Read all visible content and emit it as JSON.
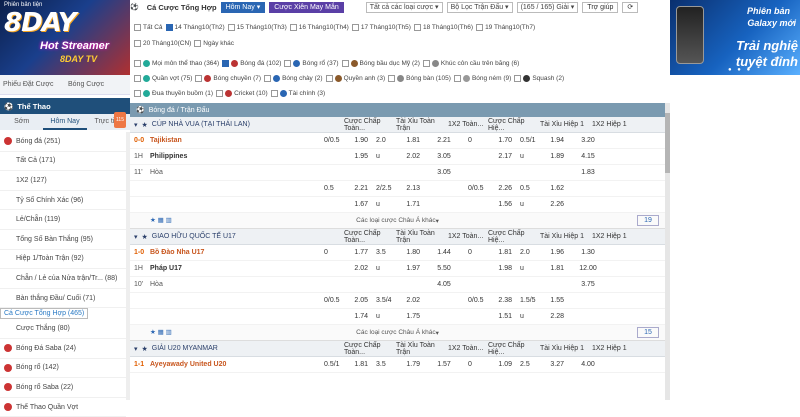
{
  "left": {
    "logo_small": "Phiên bản tiện",
    "logo_text": "8DAY",
    "logo_hot": "Hot Streamer",
    "logo_hot2": "8DAY TV",
    "select1": "Phiếu Đặt Cược",
    "select2": "Bóng Cược",
    "sport_header": "Thể Thao",
    "tabs": [
      "Sớm",
      "Hôm Nay",
      "Trực tiếp"
    ],
    "tab_badge": "115",
    "items": [
      {
        "label": "Bóng đá (251)",
        "cat": true
      },
      {
        "label": "Tất Cả (171)"
      },
      {
        "label": "1X2 (127)"
      },
      {
        "label": "Tỷ Số Chính Xác (96)"
      },
      {
        "label": "Lẻ/Chẵn (119)"
      },
      {
        "label": "Tổng Số Bàn Thắng (95)"
      },
      {
        "label": "Hiệp 1/Toàn Trận (92)"
      },
      {
        "label": "Chẵn / Lẻ của Nửa trận/Tr... (88)"
      },
      {
        "label": "Bàn thắng Đầu/ Cuối (71)"
      },
      {
        "label": "Cá Cược Tổng Hợp (465)",
        "sel": true
      },
      {
        "label": "Cược Thắng (80)"
      },
      {
        "label": "Bóng Đá Saba (24)",
        "cat": true
      },
      {
        "label": "Bóng rổ (142)",
        "cat": true
      },
      {
        "label": "Bóng rổ Saba (22)",
        "cat": true
      },
      {
        "label": "Thể Thao Quần Vợt",
        "cat": true
      }
    ]
  },
  "header": {
    "title": "Cá Cược Tổng Hợp",
    "today": "Hôm Nay",
    "xien": "Cược Xiên May Mắn",
    "sel_types": "Tất cả các loại cược",
    "sel_filter": "Bộ Lọc Trận Đấu",
    "sel_count": "(165 / 165) Giải",
    "help": "Trợ giúp"
  },
  "dates": [
    "Tất Cả",
    "14 Tháng10(Th2)",
    "15 Tháng10(Th3)",
    "16 Tháng10(Th4)",
    "17 Tháng10(Th5)",
    "18 Tháng10(Th6)",
    "19 Tháng10(Th7)",
    "20 Tháng10(CN)",
    "Ngày khác"
  ],
  "filters1": [
    "Mọi môn thể thao (364)",
    "Bóng đá (102)",
    "Bóng rổ (37)",
    "Bóng bầu dục Mỹ (2)",
    "Khúc côn cầu trên băng (6)"
  ],
  "filters2": [
    "Quần vợt (75)",
    "Bóng chuyền (7)",
    "Bóng chày (2)",
    "Quyền anh (3)",
    "Bóng bàn (105)",
    "Bóng ném (9)",
    "Squash (2)"
  ],
  "filters3": [
    "Đua thuyền buồm (1)",
    "Cricket (10)",
    "Tài chính (3)"
  ],
  "banner": {
    "t1": "Phiên bản",
    "t2": "Galaxy mới",
    "t3": "Trải nghiệ",
    "t4": "tuyệt đỉnh"
  },
  "section_title": "Bóng đá / Trận Đấu",
  "columns": [
    "Cược Chấp Toàn...",
    "Tài Xỉu Toàn Trận",
    "1X2 Toàn...",
    "Cược Chấp Hiệ...",
    "Tài Xỉu Hiệp 1",
    "1X2 Hiệp 1"
  ],
  "leagues": [
    {
      "name": "CÚP NHÀ VUA (TẠI THÁI LAN)",
      "score": "0-0",
      "time": "1H",
      "min": "11'",
      "home": "Tajikistan",
      "away": "Philippines",
      "draw": "Hòa",
      "rows": [
        [
          "0/0.5",
          "1.90",
          "2.0",
          "1.81",
          "2.21",
          "0",
          "1.70",
          "0.5/1",
          "1.94",
          "3.20"
        ],
        [
          "",
          "1.95",
          "u",
          "2.02",
          "3.05",
          "",
          "2.17",
          "u",
          "1.89",
          "4.15"
        ],
        [
          "",
          "",
          "",
          "",
          "3.05",
          "",
          "",
          "",
          "",
          "1.83"
        ],
        [
          "0.5",
          "2.21",
          "2/2.5",
          "2.13",
          "",
          "0/0.5",
          "2.26",
          "0.5",
          "1.62",
          ""
        ],
        [
          "",
          "1.67",
          "u",
          "1.71",
          "",
          "",
          "1.56",
          "u",
          "2.26",
          ""
        ]
      ],
      "more": "Các loại cược Châu Á khác",
      "page": "19"
    },
    {
      "name": "GIAO HỮU QUỐC TẾ U17",
      "score": "1-0",
      "time": "1H",
      "min": "10'",
      "home": "Bồ Đào Nha U17",
      "away": "Pháp U17",
      "draw": "Hòa",
      "rows": [
        [
          "0",
          "1.77",
          "3.5",
          "1.80",
          "1.44",
          "0",
          "1.81",
          "2.0",
          "1.96",
          "1.30"
        ],
        [
          "",
          "2.02",
          "u",
          "1.97",
          "5.50",
          "",
          "1.98",
          "u",
          "1.81",
          "12.00"
        ],
        [
          "",
          "",
          "",
          "",
          "4.05",
          "",
          "",
          "",
          "",
          "3.75"
        ],
        [
          "0/0.5",
          "2.05",
          "3.5/4",
          "2.02",
          "",
          "0/0.5",
          "2.38",
          "1.5/5",
          "1.55",
          ""
        ],
        [
          "",
          "1.74",
          "u",
          "1.75",
          "",
          "",
          "1.51",
          "u",
          "2.28",
          ""
        ]
      ],
      "more": "Các loại cược Châu Á khác",
      "page": "15"
    },
    {
      "name": "GIẢI U20 MYANMAR",
      "score": "1-1",
      "home": "Ayeyawady United U20",
      "rows": [
        [
          "0.5/1",
          "1.81",
          "3.5",
          "1.79",
          "1.57",
          "0",
          "1.09",
          "2.5",
          "3.27",
          "4.00"
        ]
      ]
    }
  ]
}
